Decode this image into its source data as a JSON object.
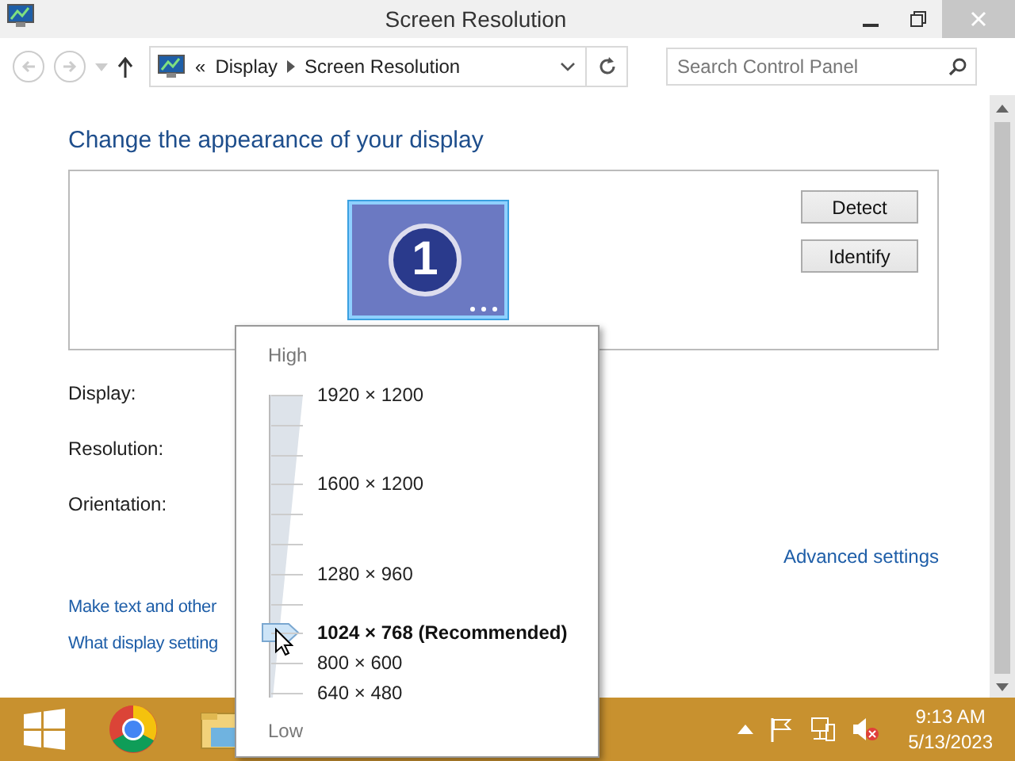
{
  "window": {
    "title": "Screen Resolution"
  },
  "address_bar": {
    "overflow": "«",
    "crumbs": [
      "Display",
      "Screen Resolution"
    ],
    "search": {
      "placeholder": "Search Control Panel"
    }
  },
  "content": {
    "heading": "Change the appearance of your display",
    "monitor_number": "1",
    "buttons": [
      "Detect",
      "Identify"
    ],
    "fields": [
      "Display:",
      "Resolution:",
      "Orientation:"
    ],
    "advanced_link": "Advanced settings",
    "links": [
      "Make text and other",
      "What display setting"
    ]
  },
  "resolution_popup": {
    "top_label": "High",
    "bottom_label": "Low",
    "level": 0.2,
    "options": [
      {
        "label": "1920 × 1200",
        "selected": false
      },
      {
        "label": "1600 × 1200",
        "selected": false
      },
      {
        "label": "1280 × 960",
        "selected": false
      },
      {
        "label": "1024 × 768 (Recommended)",
        "selected": true
      },
      {
        "label": "800 × 600",
        "selected": false
      },
      {
        "label": "640 × 480",
        "selected": false
      }
    ]
  },
  "taskbar": {
    "time": "9:13 AM",
    "date": "5/13/2023"
  }
}
